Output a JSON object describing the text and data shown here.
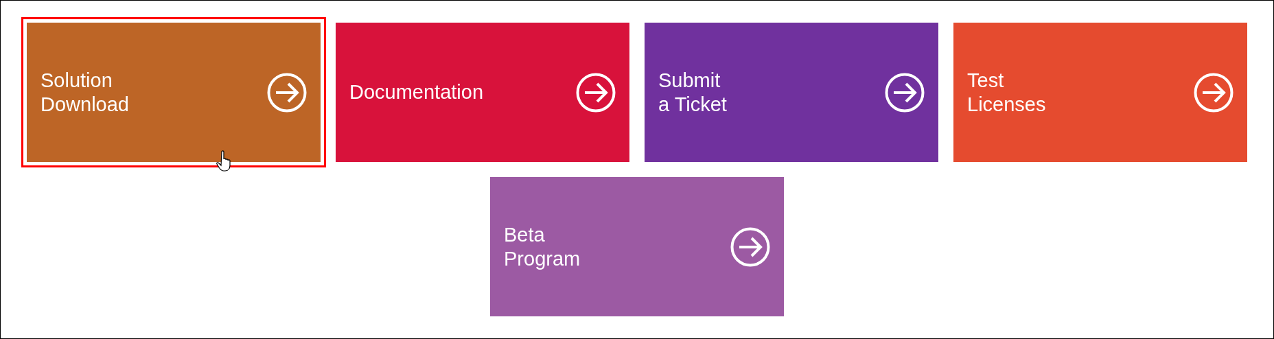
{
  "tiles": [
    {
      "title": "Solution\nDownload",
      "color": "#bd6526",
      "selected": true
    },
    {
      "title": "Documentation",
      "color": "#d8123b",
      "selected": false
    },
    {
      "title": "Submit\na Ticket",
      "color": "#70319e",
      "selected": false
    },
    {
      "title": "Test\nLicenses",
      "color": "#e54b2f",
      "selected": false
    },
    {
      "title": "Beta\nProgram",
      "color": "#9c5aa3",
      "selected": false
    }
  ]
}
